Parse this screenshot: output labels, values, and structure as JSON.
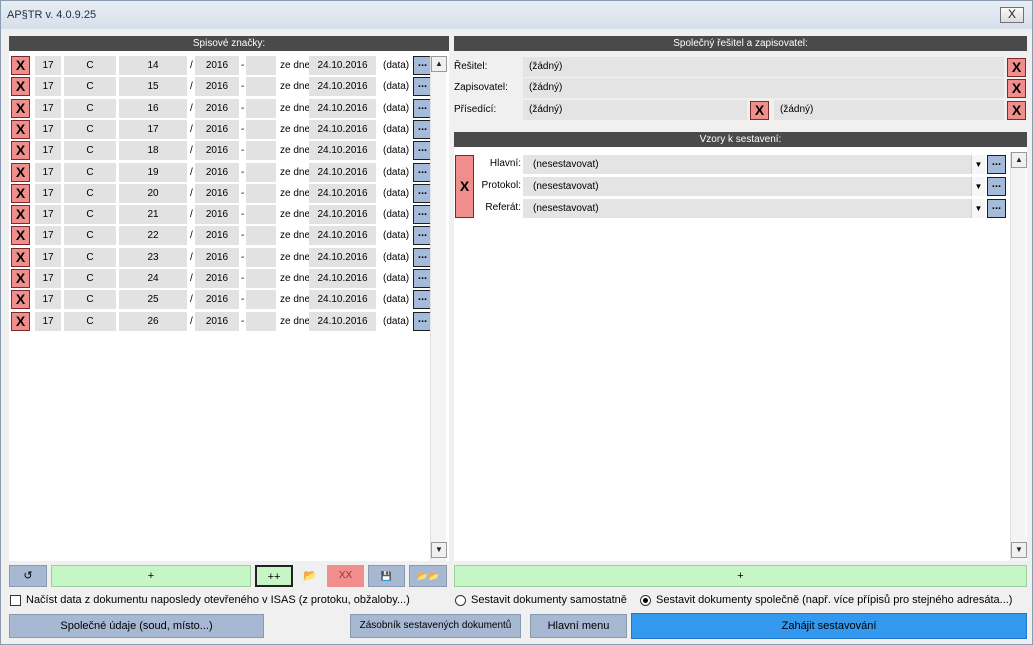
{
  "window": {
    "title": "AP§TR  v. 4.0.9.25",
    "close_glyph": "X"
  },
  "left_panel": {
    "header": "Spisové značky:",
    "rows": [
      {
        "num": "17",
        "type": "C",
        "number": "14",
        "slash": "/",
        "year": "2016",
        "dash": "-",
        "extra": "",
        "ze_dne": "ze dne:",
        "date": "24.10.2016",
        "data": "(data)"
      },
      {
        "num": "17",
        "type": "C",
        "number": "15",
        "slash": "/",
        "year": "2016",
        "dash": "-",
        "extra": "",
        "ze_dne": "ze dne:",
        "date": "24.10.2016",
        "data": "(data)"
      },
      {
        "num": "17",
        "type": "C",
        "number": "16",
        "slash": "/",
        "year": "2016",
        "dash": "-",
        "extra": "",
        "ze_dne": "ze dne:",
        "date": "24.10.2016",
        "data": "(data)"
      },
      {
        "num": "17",
        "type": "C",
        "number": "17",
        "slash": "/",
        "year": "2016",
        "dash": "-",
        "extra": "",
        "ze_dne": "ze dne:",
        "date": "24.10.2016",
        "data": "(data)"
      },
      {
        "num": "17",
        "type": "C",
        "number": "18",
        "slash": "/",
        "year": "2016",
        "dash": "-",
        "extra": "",
        "ze_dne": "ze dne:",
        "date": "24.10.2016",
        "data": "(data)"
      },
      {
        "num": "17",
        "type": "C",
        "number": "19",
        "slash": "/",
        "year": "2016",
        "dash": "-",
        "extra": "",
        "ze_dne": "ze dne:",
        "date": "24.10.2016",
        "data": "(data)"
      },
      {
        "num": "17",
        "type": "C",
        "number": "20",
        "slash": "/",
        "year": "2016",
        "dash": "-",
        "extra": "",
        "ze_dne": "ze dne:",
        "date": "24.10.2016",
        "data": "(data)"
      },
      {
        "num": "17",
        "type": "C",
        "number": "21",
        "slash": "/",
        "year": "2016",
        "dash": "-",
        "extra": "",
        "ze_dne": "ze dne:",
        "date": "24.10.2016",
        "data": "(data)"
      },
      {
        "num": "17",
        "type": "C",
        "number": "22",
        "slash": "/",
        "year": "2016",
        "dash": "-",
        "extra": "",
        "ze_dne": "ze dne:",
        "date": "24.10.2016",
        "data": "(data)"
      },
      {
        "num": "17",
        "type": "C",
        "number": "23",
        "slash": "/",
        "year": "2016",
        "dash": "-",
        "extra": "",
        "ze_dne": "ze dne:",
        "date": "24.10.2016",
        "data": "(data)"
      },
      {
        "num": "17",
        "type": "C",
        "number": "24",
        "slash": "/",
        "year": "2016",
        "dash": "-",
        "extra": "",
        "ze_dne": "ze dne:",
        "date": "24.10.2016",
        "data": "(data)"
      },
      {
        "num": "17",
        "type": "C",
        "number": "25",
        "slash": "/",
        "year": "2016",
        "dash": "-",
        "extra": "",
        "ze_dne": "ze dne:",
        "date": "24.10.2016",
        "data": "(data)"
      },
      {
        "num": "17",
        "type": "C",
        "number": "26",
        "slash": "/",
        "year": "2016",
        "dash": "-",
        "extra": "",
        "ze_dne": "ze dne:",
        "date": "24.10.2016",
        "data": "(data)"
      }
    ],
    "delete_glyph": "X",
    "more_glyph": "...",
    "toolbar": {
      "refresh": "↺",
      "add": "+",
      "add_more": "++",
      "open": "📂",
      "delete_all": "XX",
      "save": "💾",
      "open_multi": "📂📂"
    },
    "checkbox_label": "Načíst data z dokumentu naposledy otevřeného v ISAS (z protoku, obžaloby...)"
  },
  "right_panel": {
    "header": "Společný řešitel a zapisovatel:",
    "resitel_label": "Řešitel:",
    "resitel_value": "(žádný)",
    "zapisovatel_label": "Zapisovatel:",
    "zapisovatel_value": "(žádný)",
    "prisedici_label": "Přísedící:",
    "prisedici_value1": "(žádný)",
    "prisedici_value2": "(žádný)"
  },
  "templates_panel": {
    "header": "Vzory k sestavení:",
    "hlavni_label": "Hlavní:",
    "hlavni_value": "(nesestavovat)",
    "protokol_label": "Protokol:",
    "protokol_value": "(nesestavovat)",
    "referat_label": "Referát:",
    "referat_value": "(nesestavovat)",
    "add": "+"
  },
  "options": {
    "separately": "Sestavit dokumenty samostatně",
    "together": "Sestavit dokumenty společně (např. více přípisů pro stejného adresáta...)",
    "selected": "together"
  },
  "bottom": {
    "common_data": "Společné údaje (soud, místo...)",
    "storage": "Zásobník sestavených dokumentů",
    "main_menu": "Hlavní menu",
    "start": "Zahájit sestavování"
  }
}
